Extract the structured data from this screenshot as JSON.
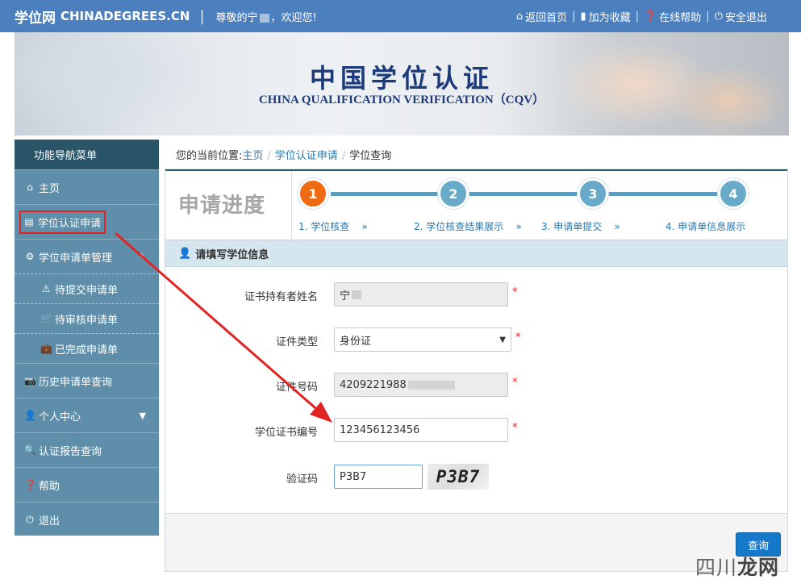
{
  "topbar": {
    "logo": "学位网",
    "logo_en": "CHINADEGREES.CN",
    "separator": "|",
    "greeting_prefix": "尊敬的宁",
    "greeting_suffix": "，欢迎您!",
    "links": [
      {
        "icon": "home-icon",
        "label": "返回首页"
      },
      {
        "icon": "bookmark-icon",
        "label": "加为收藏"
      },
      {
        "icon": "help-icon",
        "label": "在线帮助"
      },
      {
        "icon": "power-icon",
        "label": "安全退出"
      }
    ]
  },
  "banner": {
    "title_cn": "中国学位认证",
    "title_en": "CHINA QUALIFICATION VERIFICATION（CQV）"
  },
  "sidebar": {
    "header": "功能导航菜单",
    "items": [
      {
        "icon": "home-icon",
        "label": "主页"
      },
      {
        "icon": "document-icon",
        "label": "学位认证申请"
      },
      {
        "icon": "gear-icon",
        "label": "学位申请单管理"
      },
      {
        "icon": "warning-icon",
        "label": "待提交申请单"
      },
      {
        "icon": "cart-icon",
        "label": "待审核申请单"
      },
      {
        "icon": "briefcase-icon",
        "label": "已完成申请单"
      },
      {
        "icon": "camera-icon",
        "label": "历史申请单查询"
      },
      {
        "icon": "user-icon",
        "label": "个人中心"
      },
      {
        "icon": "search-icon",
        "label": "认证报告查询"
      },
      {
        "icon": "help-icon",
        "label": "帮助"
      },
      {
        "icon": "power-icon",
        "label": "退出"
      }
    ]
  },
  "breadcrumb": {
    "prefix": "您的当前位置:",
    "home": "主页",
    "parent": "学位认证申请",
    "current": "学位查询",
    "sep": "/"
  },
  "progress": {
    "title": "申请进度",
    "steps": [
      {
        "number": "1",
        "label": "1. 学位核查",
        "arrow": "»"
      },
      {
        "number": "2",
        "label": "2. 学位核查结果展示",
        "arrow": "»"
      },
      {
        "number": "3",
        "label": "3. 申请单提交",
        "arrow": "»"
      },
      {
        "number": "4",
        "label": "4. 申请单信息展示"
      }
    ],
    "active_step": 1
  },
  "form": {
    "section_title": "请填写学位信息",
    "required_mark": "*",
    "fields": [
      {
        "label": "证书持有者姓名",
        "value": "宁"
      },
      {
        "label": "证件类型",
        "value": "身份证"
      },
      {
        "label": "证件号码",
        "value": "4209221988"
      },
      {
        "label": "学位证书编号",
        "value": "123456123456"
      },
      {
        "label": "验证码",
        "value": "P3B7"
      }
    ],
    "captcha_text": "P3B7",
    "submit_label": "查询"
  },
  "watermark": {
    "text_a": "四川",
    "text_b": "龙网"
  },
  "colors": {
    "topbar": "#4c7fbd",
    "sidebar": "#5e8ea9",
    "sidebar_header": "#2a5468",
    "active_step": "#ef6b13",
    "step": "#69a9ca",
    "link": "#2a7ab0",
    "highlight": "#e02424",
    "button": "#1678c8"
  }
}
